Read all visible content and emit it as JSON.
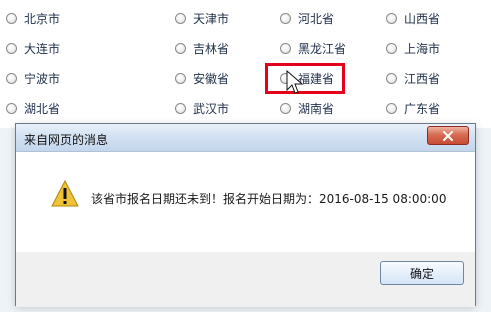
{
  "cities": [
    {
      "label": "北京市"
    },
    {
      "label": "天津市"
    },
    {
      "label": "河北省"
    },
    {
      "label": "山西省"
    },
    {
      "label": "大连市"
    },
    {
      "label": "吉林省"
    },
    {
      "label": "黑龙江省"
    },
    {
      "label": "上海市"
    },
    {
      "label": "宁波市"
    },
    {
      "label": "安徽省"
    },
    {
      "label": "福建省"
    },
    {
      "label": "江西省"
    },
    {
      "label": "湖北省"
    },
    {
      "label": "武汉市"
    },
    {
      "label": "湖南省"
    },
    {
      "label": "广东省"
    }
  ],
  "dialog": {
    "title": "来自网页的消息",
    "message": "该省市报名日期还未到！报名开始日期为：2016-08-15 08:00:00",
    "ok_label": "确定"
  },
  "icons": {
    "radio": "radio-button-icon",
    "warning": "warning-icon",
    "close": "close-icon",
    "cursor": "mouse-pointer-icon"
  },
  "colors": {
    "highlight": "#e3001b",
    "close_button": "#c84c34",
    "warning": "#f0c23a"
  }
}
